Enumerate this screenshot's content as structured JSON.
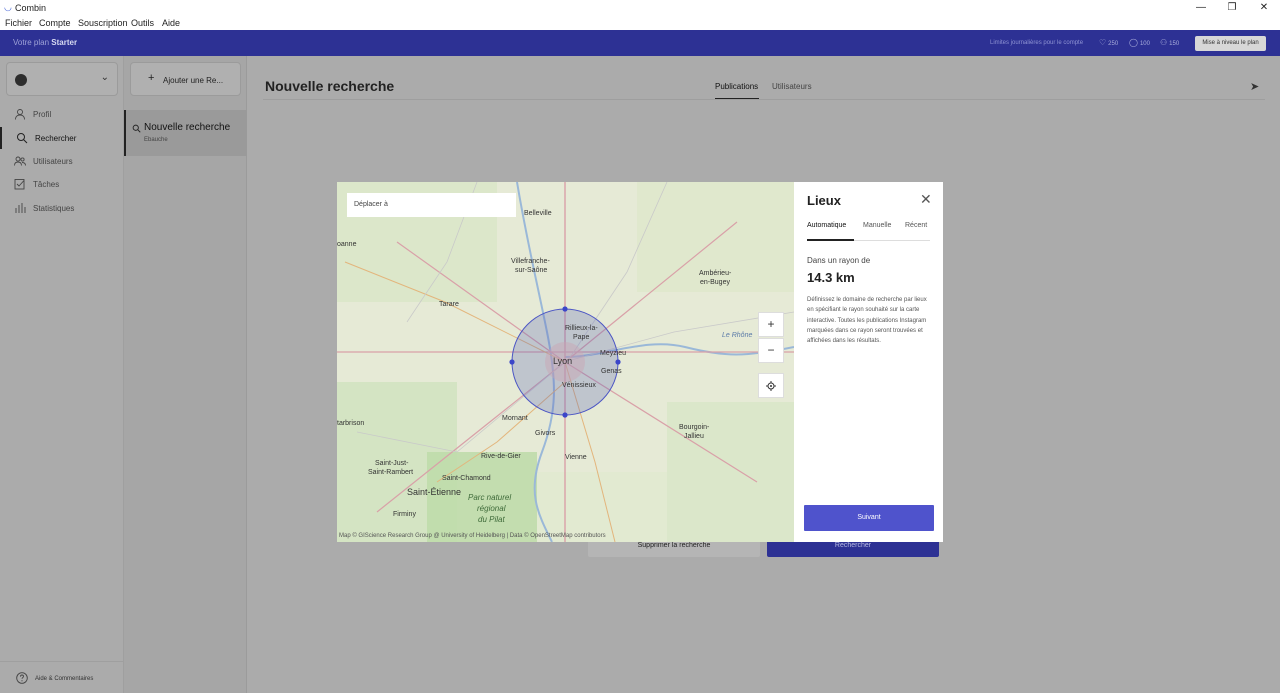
{
  "window": {
    "title": "Combin",
    "logo_icon": "combin-logo-icon",
    "controls": [
      "—",
      "❐",
      "✕"
    ]
  },
  "menu": {
    "items": [
      "Fichier",
      "Compte",
      "Souscription",
      "Outils",
      "Aide"
    ]
  },
  "plan_bar": {
    "plan_prefix": "Votre plan",
    "plan_name": "Starter",
    "limits_label": "Limites journalières pour le compte",
    "likes": "250",
    "comments": "100",
    "follows": "150",
    "upgrade_label": "Mise à niveau le plan",
    "bg_color": "#2d3194"
  },
  "sidebar": {
    "account_chevron": "⌄",
    "items": [
      {
        "label": "Profil",
        "icon": "user-icon"
      },
      {
        "label": "Rechercher",
        "icon": "search-icon"
      },
      {
        "label": "Utilisateurs",
        "icon": "users-icon"
      },
      {
        "label": "Tâches",
        "icon": "tasks-icon"
      },
      {
        "label": "Statistiques",
        "icon": "stats-icon"
      }
    ],
    "active_index": 1,
    "help_label": "Aide & Commentaires"
  },
  "searches": {
    "add_label": "Ajouter une Re...",
    "items": [
      {
        "title": "Nouvelle recherche",
        "subtitle": "Ebauche"
      }
    ]
  },
  "content": {
    "title": "Nouvelle recherche",
    "tabs": [
      "Publications",
      "Utilisateurs"
    ],
    "active_tab": 0,
    "delete_label": "Supprimer la recherche",
    "search_label": "Rechercher"
  },
  "modal": {
    "map": {
      "search_placeholder": "Déplacer à",
      "zoom_in": "+",
      "zoom_out": "−",
      "attribution": "Map © GIScience Research Group @ University of Heidelberg | Data © OpenStreetMap contributors",
      "labels": {
        "belleville": "Belleville",
        "villefranche1": "Villefranche-",
        "villefranche2": "sur-Saône",
        "amberieu1": "Ambérieu-",
        "amberieu2": "en-Bugey",
        "tarare": "Tarare",
        "rillieux1": "Rillieux-la-",
        "rillieux2": "Pape",
        "lyon": "Lyon",
        "meyzieu": "Meyzieu",
        "genas": "Genas",
        "venissieux": "Vénissieux",
        "lerhone": "Le Rhône",
        "mornant": "Mornant",
        "givors": "Givors",
        "bourgoin1": "Bourgoin-",
        "bourgoin2": "Jallieu",
        "tarbrison": "tarbrison",
        "rivedegier": "Rive-de-Gier",
        "vienne": "Vienne",
        "saintjust1": "Saint-Just-",
        "saintjust2": "Saint-Rambert",
        "saintchamond": "Saint-Chamond",
        "saintetienne": "Saint-Étienne",
        "parc1": "Parc naturel",
        "parc2": "régional",
        "parc3": "du Pilat",
        "firminy": "Firminy",
        "roanne": "oanne"
      }
    },
    "panel": {
      "title": "Lieux",
      "tabs": [
        "Automatique",
        "Manuelle",
        "Récent"
      ],
      "active_tab": 0,
      "radius_label": "Dans un rayon de",
      "radius_value": "14.3 km",
      "description": "Définissez le domaine de recherche par lieux en spécifiant le rayon souhaité sur la carte interactive. Toutes les publications Instagram marquées dans ce rayon seront trouvées et affichées dans les résultats.",
      "next_label": "Suivant",
      "accent_color": "#4f53cc"
    }
  }
}
